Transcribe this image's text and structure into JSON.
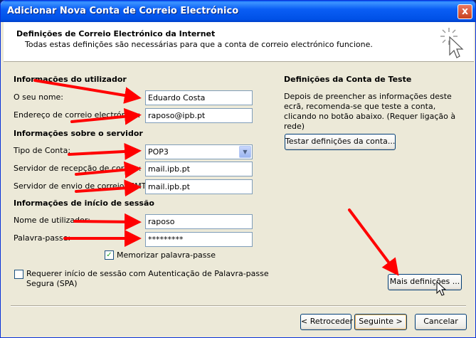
{
  "window": {
    "title": "Adicionar Nova Conta de Correio Electrónico",
    "close_glyph": "x"
  },
  "header": {
    "title": "Definições de Correio Electrónico da Internet",
    "subtitle": "Todas estas definições são necessárias para que a conta de correio electrónico funcione."
  },
  "user_info": {
    "heading": "Informações do utilizador",
    "name_label": "O seu nome:",
    "name_value": "Eduardo Costa",
    "email_label": "Endereço de correio electrónico:",
    "email_value": "raposo@ipb.pt"
  },
  "server_info": {
    "heading": "Informações sobre o servidor",
    "account_type_label": "Tipo de Conta:",
    "account_type_value": "POP3",
    "incoming_label": "Servidor de recepção de correio:",
    "incoming_value": "mail.ipb.pt",
    "outgoing_label": "Servidor de envio de correio (SMTP):",
    "outgoing_value": "mail.ipb.pt"
  },
  "logon_info": {
    "heading": "Informações de início de sessão",
    "username_label": "Nome de utilizador:",
    "username_value": "raposo",
    "password_label": "Palavra-passe:",
    "password_value": "*********",
    "remember_label": "Memorizar palavra-passe",
    "remember_checked": true,
    "spa_label_line1": "Requerer início de sessão com Autenticação de Palavra-passe",
    "spa_label_line2": "Segura (SPA)",
    "spa_checked": false
  },
  "test_settings": {
    "heading": "Definições da Conta de Teste",
    "description": "Depois de preencher as informações deste ecrã, recomenda-se que teste a conta, clicando no botão abaixo. (Requer ligação à rede)",
    "test_button": "Testar definições da conta..."
  },
  "buttons": {
    "more_settings": "Mais definições ...",
    "back": "< Retroceder",
    "next": "Seguinte >",
    "cancel": "Cancelar"
  },
  "colors": {
    "annotation_arrow": "#ff0000",
    "title_bar": "#0a5ef5",
    "dialog_bg": "#ece9d8"
  }
}
